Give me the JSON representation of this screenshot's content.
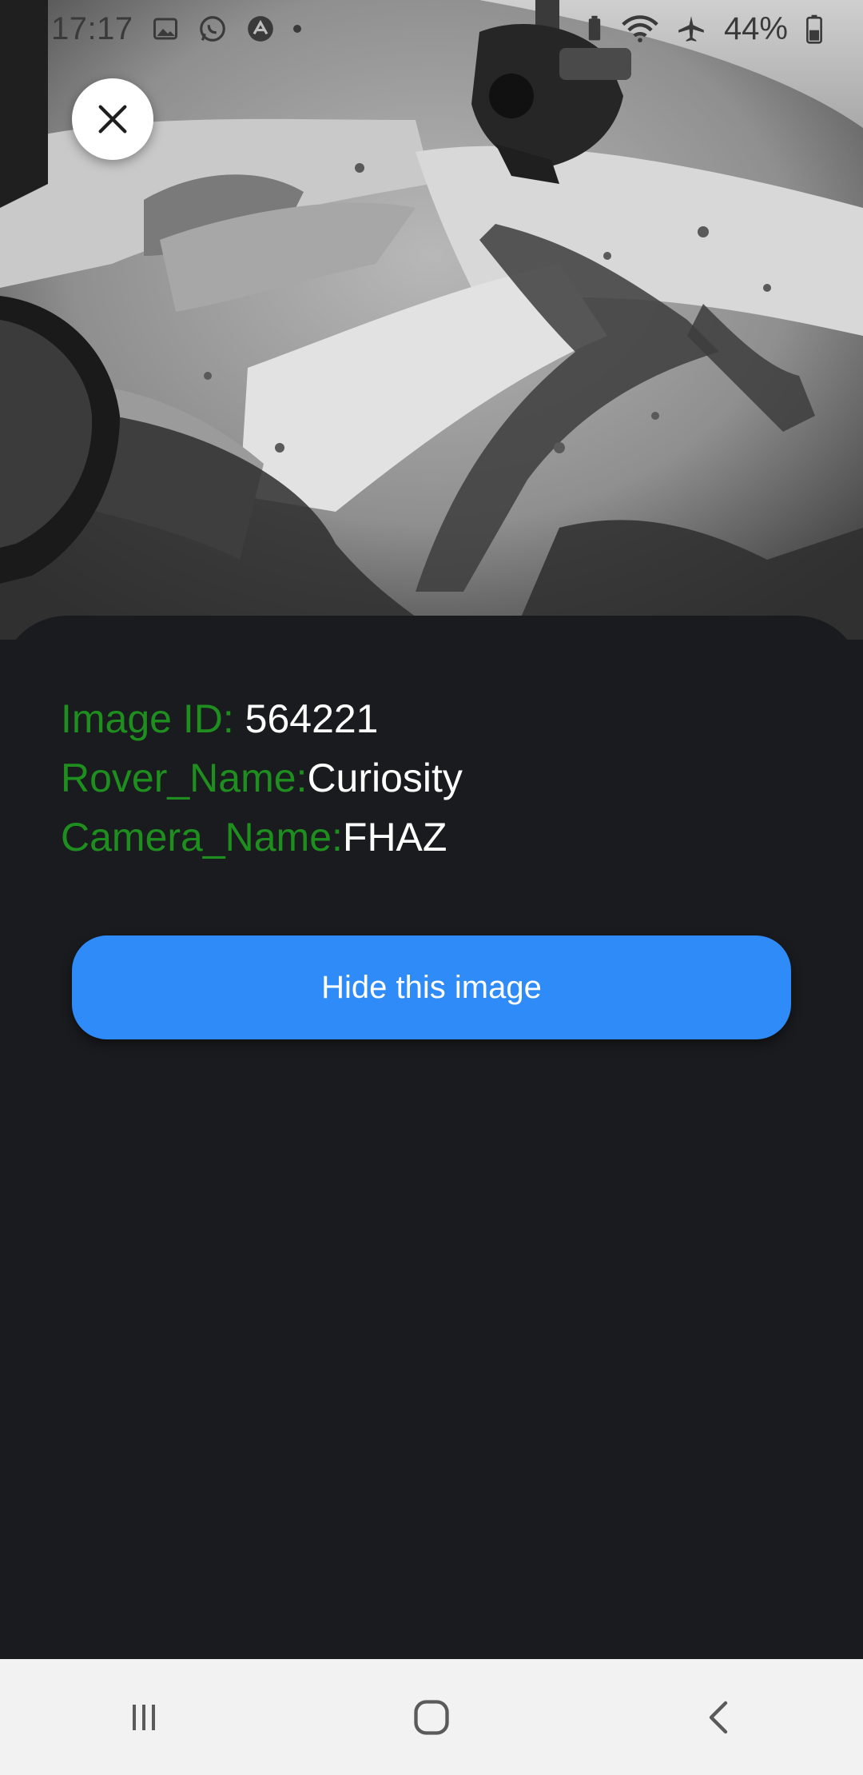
{
  "status_bar": {
    "time": "17:17",
    "battery": "44%",
    "icons_left": [
      "gallery-icon",
      "whatsapp-icon",
      "app-icon",
      "dot"
    ],
    "icons_right": [
      "battery-saver-icon",
      "wifi-icon",
      "airplane-icon",
      "battery-icon"
    ]
  },
  "photo": {
    "description_icon": "mars-surface-photo"
  },
  "close_button": {
    "icon": "close-icon"
  },
  "details": {
    "image_id_label": "Image ID: ",
    "image_id_value": "564221",
    "rover_label": "Rover_Name:",
    "rover_value": "Curiosity",
    "camera_label": "Camera_Name:",
    "camera_value": "FHAZ"
  },
  "actions": {
    "hide_label": "Hide this image"
  },
  "nav_bar": {
    "buttons": [
      "recent-apps-icon",
      "home-icon",
      "back-icon"
    ]
  },
  "colors": {
    "sheet_background": "#1a1b1e",
    "label_green": "#1e8f1e",
    "value_white": "#ffffff",
    "button_blue": "#2f8bf7",
    "nav_background": "#f2f2f2"
  }
}
